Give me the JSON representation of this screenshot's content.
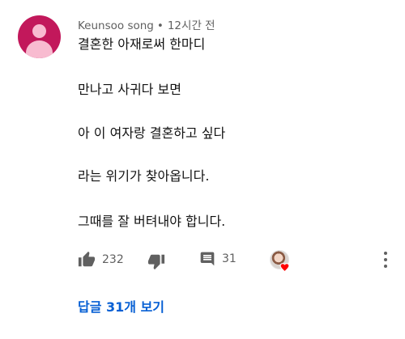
{
  "comment": {
    "author": "Keunsoo song",
    "separator": "•",
    "timestamp": "12시간 전",
    "lines": [
      "결혼한 아재로써 한마디",
      "만나고 사귀다 보면",
      "아 이 여자랑 결혼하고 싶다",
      "라는 위기가 찾아옵니다.",
      "그때를 잘 버텨내야 합니다."
    ],
    "avatar_color": "#c2185b"
  },
  "actions": {
    "like_icon": "thumbs-up-icon",
    "like_count": "232",
    "dislike_icon": "thumbs-down-icon",
    "reply_icon": "comment-icon",
    "reply_count": "31",
    "creator_heart_icon": "creator-heart-icon",
    "heart_color": "#ff0000",
    "menu_icon": "more-vert-icon"
  },
  "replies_link": {
    "label": "답글 31개 보기",
    "color": "#065fd4"
  }
}
